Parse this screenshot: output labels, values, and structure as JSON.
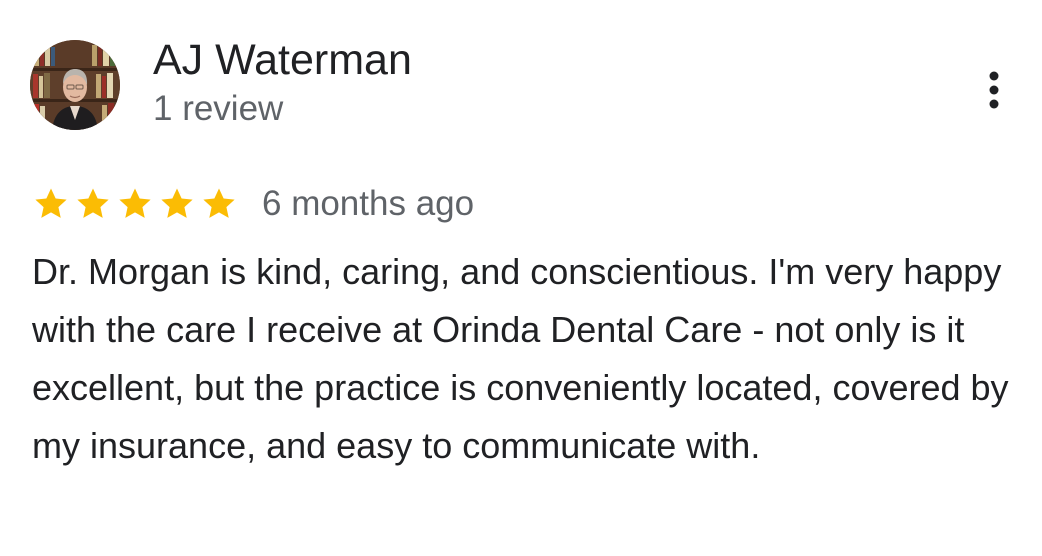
{
  "reviewer": {
    "name": "AJ Waterman",
    "review_count": "1 review",
    "avatar_icon": "bookshelf-portrait-avatar"
  },
  "menu": {
    "icon": "more-vertical-icon"
  },
  "review": {
    "rating": 5,
    "max_rating": 5,
    "star_color": "#fbbc04",
    "time": "6 months ago",
    "text": "Dr. Morgan is kind, caring, and conscientious. I'm very happy with the care I receive at Orinda Dental Care - not only is it excellent, but the practice is conveniently located, covered by my insurance, and easy to communicate with."
  }
}
